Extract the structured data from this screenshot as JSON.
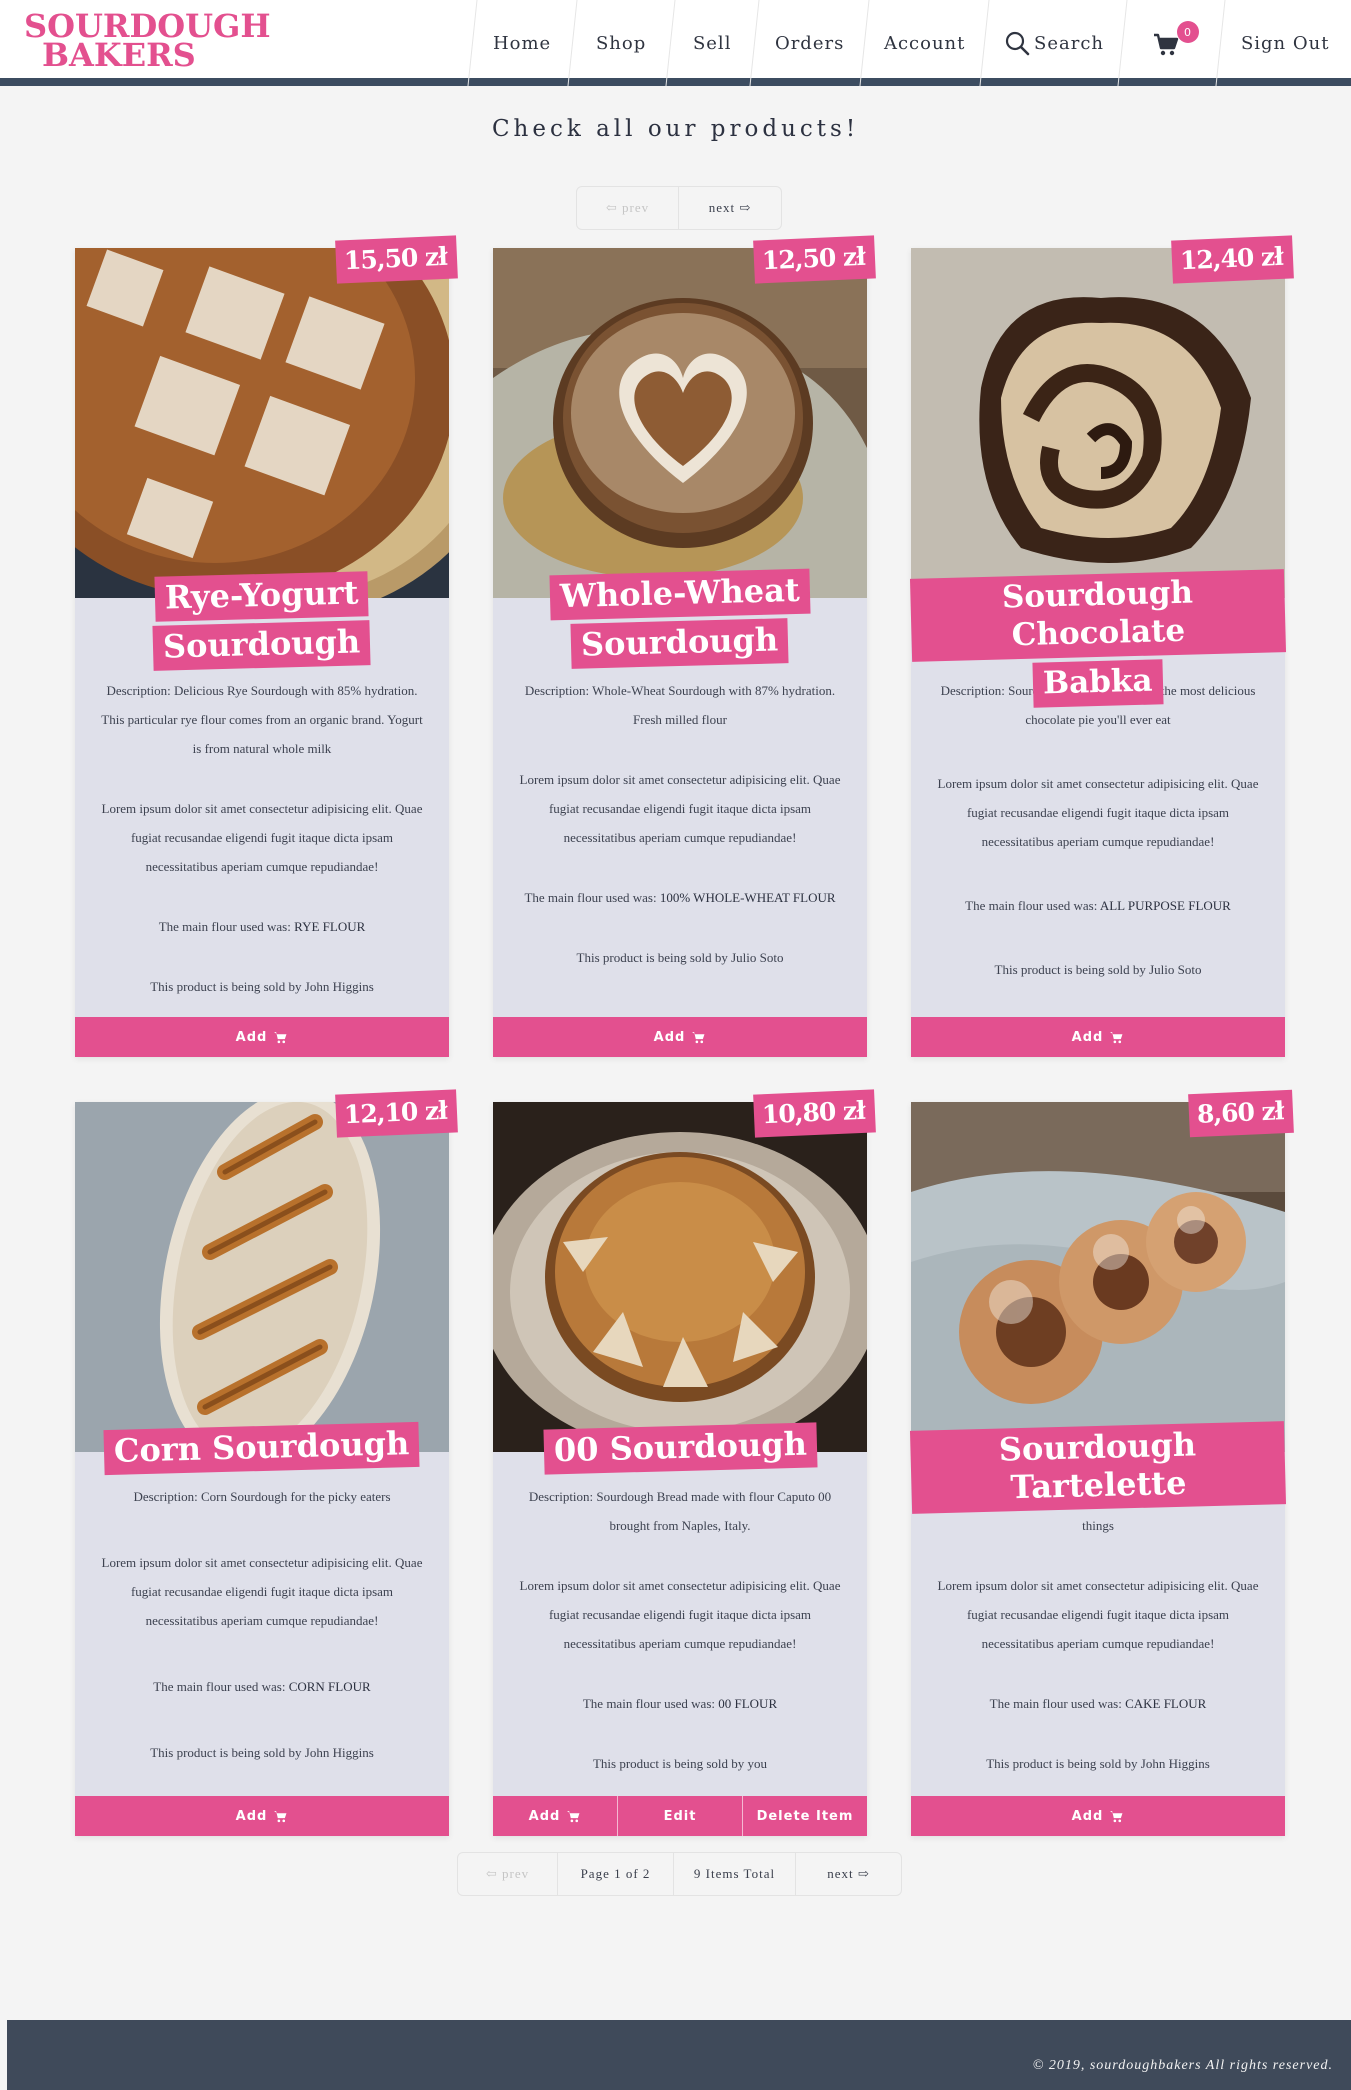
{
  "brand": {
    "line1": "SOURDOUGH",
    "line2": "BAKERS",
    "color": "#e3508f"
  },
  "nav": {
    "home": "Home",
    "shop": "Shop",
    "sell": "Sell",
    "orders": "Orders",
    "account": "Account",
    "search": "Search",
    "cart_count": "0",
    "sign_out": "Sign Out"
  },
  "page_title": "Check all our products!",
  "pager_top": {
    "prev": "⇦ prev",
    "next": "next ⇨"
  },
  "labels": {
    "flour_prefix": "The main flour used was: ",
    "add": "Add",
    "edit": "Edit",
    "delete": "Delete Item"
  },
  "products": [
    {
      "price": "15,50 zł",
      "title_line1": "Rye-Yogurt",
      "title_line2": "Sourdough",
      "description": "Description: Delicious Rye Sourdough with 85% hydration. This particular rye flour comes from an organic brand. Yogurt is from natural whole milk",
      "lorem": "Lorem ipsum dolor sit amet consectetur adipisicing elit. Quae fugiat recusandae eligendi fugit itaque dicta ipsam necessitatibus aperiam cumque repudiandae!",
      "flour": "RYE FLOUR",
      "seller": "This product is being sold by John Higgins"
    },
    {
      "price": "12,50 zł",
      "title_line1": "Whole-Wheat",
      "title_line2": "Sourdough",
      "description": "Description: Whole-Wheat Sourdough with 87% hydration. Fresh milled flour",
      "lorem": "Lorem ipsum dolor sit amet consectetur adipisicing elit. Quae fugiat recusandae eligendi fugit itaque dicta ipsam necessitatibus aperiam cumque repudiandae!",
      "flour": "100% WHOLE-WHEAT FLOUR",
      "seller": "This product is being sold by Julio Soto"
    },
    {
      "price": "12,40 zł",
      "title_line1": "Sourdough Chocolate",
      "title_line2": "Babka",
      "description": "Description: Sourdough Chocolate Babka the most delicious chocolate pie you'll ever eat",
      "lorem": "Lorem ipsum dolor sit amet consectetur adipisicing elit. Quae fugiat recusandae eligendi fugit itaque dicta ipsam necessitatibus aperiam cumque repudiandae!",
      "flour": "ALL PURPOSE FLOUR",
      "seller": "This product is being sold by Julio Soto"
    },
    {
      "price": "12,10 zł",
      "title_line1": "Corn Sourdough",
      "description": "Description: Corn Sourdough for the picky eaters",
      "lorem": "Lorem ipsum dolor sit amet consectetur adipisicing elit. Quae fugiat recusandae eligendi fugit itaque dicta ipsam necessitatibus aperiam cumque repudiandae!",
      "flour": "CORN FLOUR",
      "seller": "This product is being sold by John Higgins"
    },
    {
      "price": "10,80 zł",
      "title_line1": "00 Sourdough",
      "description": "Description: Sourdough Bread made with flour Caputo 00 brought from Naples, Italy.",
      "lorem": "Lorem ipsum dolor sit amet consectetur adipisicing elit. Quae fugiat recusandae eligendi fugit itaque dicta ipsam necessitatibus aperiam cumque repudiandae!",
      "flour": "00 FLOUR",
      "seller": "This product is being sold by you"
    },
    {
      "price": "8,60 zł",
      "title_line1": "Sourdough Tartelette",
      "description": "Description: Sourdough Tartelette filled with so many yummy things",
      "lorem": "Lorem ipsum dolor sit amet consectetur adipisicing elit. Quae fugiat recusandae eligendi fugit itaque dicta ipsam necessitatibus aperiam cumque repudiandae!",
      "flour": "CAKE FLOUR",
      "seller": "This product is being sold by John Higgins"
    }
  ],
  "pager_bottom": {
    "prev": "⇦ prev",
    "page": "Page 1 of 2",
    "total": "9 Items Total",
    "next": "next ⇨"
  },
  "footer": {
    "copyright": "© 2019, sourdoughbakers All rights reserved."
  }
}
